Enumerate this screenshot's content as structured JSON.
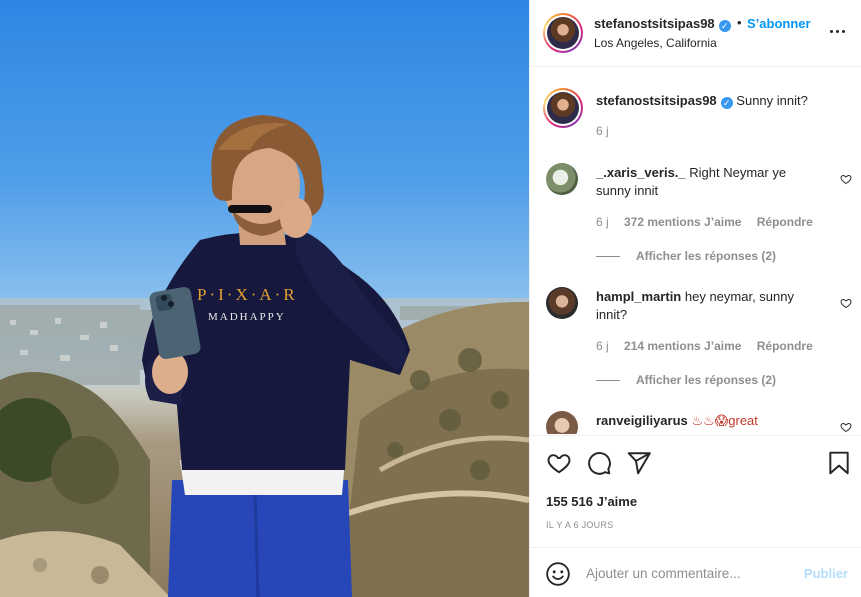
{
  "post": {
    "username": "stefanostsitsipas98",
    "verified_mark": "✓",
    "dot": "•",
    "follow_label": "S’abonner",
    "location": "Los Angeles, California",
    "more_icon": "more-horizontal-icon"
  },
  "caption": {
    "username": "stefanostsitsipas98",
    "text": "Sunny innit?",
    "time": "6 j"
  },
  "comments": [
    {
      "username": "_.xaris_veris._",
      "text": "Right Neymar ye sunny innit",
      "time": "6 j",
      "likes": "372 mentions J’aime",
      "reply": "Répondre",
      "view_replies": "Afficher les réponses (2)"
    },
    {
      "username": "hampl_martin",
      "text": "hey neymar, sunny innit?",
      "time": "6 j",
      "likes": "214 mentions J’aime",
      "reply": "Répondre",
      "view_replies": "Afficher les réponses (2)"
    },
    {
      "username": "ranveigiliyarus",
      "text": "♨♨😱great"
    }
  ],
  "actions": {
    "like_icon": "heart-icon",
    "comment_icon": "comment-icon",
    "share_icon": "share-icon",
    "save_icon": "bookmark-icon",
    "likes": "155 516 J’aime",
    "time": "IL Y A 6 JOURS"
  },
  "add_comment": {
    "placeholder": "Ajouter un commentaire...",
    "publish": "Publier"
  },
  "photo_text": {
    "line1": "P·I·X·A·R",
    "line2": "MADHAPPY"
  },
  "colors": {
    "link_blue": "#0095f6",
    "publish_disabled": "#b2dffc",
    "secondary_text": "#8e8e8e",
    "border": "#efefef"
  }
}
